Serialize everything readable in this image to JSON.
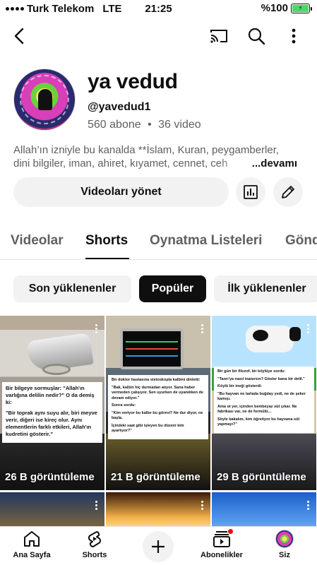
{
  "status_bar": {
    "carrier": "Turk Telekom",
    "network": "LTE",
    "time": "21:25",
    "battery": "%100",
    "battery_level": 1.0
  },
  "header": {
    "back_icon": "chevron-left-icon",
    "cast_icon": "cast-icon",
    "search_icon": "search-icon",
    "more_icon": "more-vertical-icon"
  },
  "channel": {
    "name": "ya vedud",
    "handle": "@yavedud1",
    "subscribers": "560 abone",
    "separator": "•",
    "videos": "36 video",
    "description_line1": "Allah’ın izniyle bu kanalda **İslam, Kuran, peygamberler,",
    "description_line2": "dini bilgiler, iman, ahiret, kıyamet, cennet, ceh",
    "description_more": "...devamı"
  },
  "actions": {
    "manage_label": "Videoları yönet",
    "analytics_icon": "bar-chart-icon",
    "edit_icon": "pencil-icon"
  },
  "tabs": [
    {
      "label": "Videolar"
    },
    {
      "label": "Shorts"
    },
    {
      "label": "Oynatma Listeleri"
    },
    {
      "label": "Gönd"
    }
  ],
  "filters": [
    {
      "label": "Son yüklenenler"
    },
    {
      "label": "Popüler"
    },
    {
      "label": "İlk yüklenenler"
    }
  ],
  "shorts": [
    {
      "views": "26 B görüntüleme",
      "caption": [
        "Bir bilgeye sormuşlar: \"Allah'ın varlığına delilin nedir?\" O da demiş ki:",
        "\"Bir toprak aynı suyu alır, biri meyve verir, diğeri ise kireç olur. Aynı elementlerin farklı etkileri, Allah'ın kudretini gösterir.\""
      ]
    },
    {
      "views": "21 B görüntüleme",
      "caption": [
        "Bir doktor hastasına stetoskopla kalbini dinletti:",
        "\"Bak, kalbin hiç durmadan atıyor. Sana haber vermeden çalışıyor. Sen uyurken de uyanıkken de devam ediyor.\"",
        "Sonra sordu:",
        "\"Kim veriyor bu kalbe bu görevi? Ne dur diyor, ne başla.",
        "İçindeki saat gibi işleyen bu düzeni kim ayarlıyor?\""
      ]
    },
    {
      "views": "29 B görüntüleme",
      "caption": [
        "Bir gün bir filozof, bir köylüye sordu:",
        "\"Tanrı'ya nasıl inanırsın? Göster bana bir delil.\"",
        "Köylü bir ineği gösterdi:",
        "\"Bu hayvan ne tarlada buğday yedi, ne de şeker kamışı.",
        "Ama ot yer, içinden bembeyaz süt çıkar. Ne fabrikası var, ne de formülü...",
        "Söyle bakalım, kim öğretiyor bu hayvana süt yapmayı?\""
      ]
    },
    {
      "views": ""
    },
    {
      "views": ""
    },
    {
      "views": ""
    }
  ],
  "bottom_nav": [
    {
      "label": "Ana Sayfa",
      "icon": "home-icon"
    },
    {
      "label": "Shorts",
      "icon": "shorts-icon"
    },
    {
      "label": "",
      "icon": "plus-icon"
    },
    {
      "label": "Abonelikler",
      "icon": "subscriptions-icon"
    },
    {
      "label": "Siz",
      "icon": "avatar"
    }
  ],
  "colors": {
    "text_primary": "#0f0f0f",
    "text_secondary": "#606060",
    "chip_bg": "#f2f2f2",
    "chip_active_bg": "#0f0f0f",
    "notification_red": "#ff0000",
    "battery_green": "#4cd964"
  }
}
